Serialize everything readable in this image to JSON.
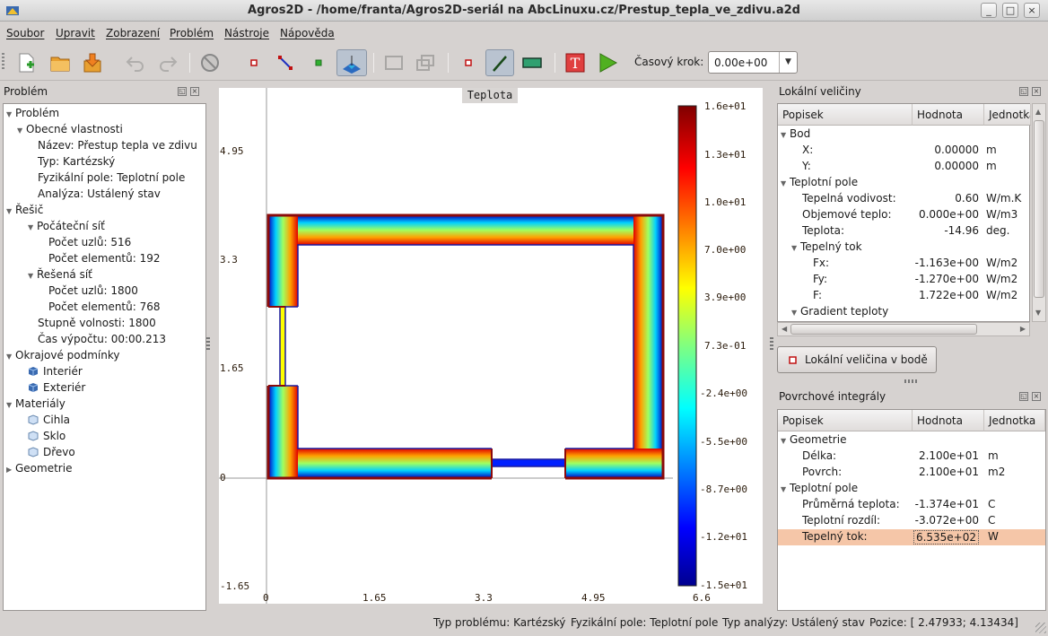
{
  "window": {
    "title": "Agros2D - /home/franta/Agros2D-seriál na AbcLinuxu.cz/Prestup_tepla_ve_zdivu.a2d"
  },
  "menu": [
    "Soubor",
    "Upravit",
    "Zobrazení",
    "Problém",
    "Nástroje",
    "Nápověda"
  ],
  "toolbar": {
    "step_label": "Časový krok:",
    "step_value": "0.00e+00"
  },
  "left_panel": {
    "title": "Problém",
    "tree": [
      "Problém",
      "Obecné vlastnosti",
      "Název: Přestup tepla ve zdivu",
      "Typ: Kartézský",
      "Fyzikální pole: Teplotní pole",
      "Analýza: Ustálený stav",
      "Řešič",
      "Počáteční síť",
      "Počet uzlů: 516",
      "Počet elementů: 192",
      "Řešená síť",
      "Počet uzlů: 1800",
      "Počet elementů: 768",
      "Stupně volnosti: 1800",
      "Čas výpočtu: 00:00.213",
      "Okrajové podmínky",
      "Interiér",
      "Exteriér",
      "Materiály",
      "Cihla",
      "Sklo",
      "Dřevo",
      "Geometrie"
    ]
  },
  "view": {
    "title": "Teplota",
    "y_ticks": [
      "4.95",
      "3.3",
      "1.65",
      "0",
      "-1.65"
    ],
    "x_ticks": [
      "0",
      "1.65",
      "3.3",
      "4.95",
      "6.6"
    ],
    "colorbar_labels": [
      "1.6e+01",
      "1.3e+01",
      "1.0e+01",
      "7.0e+00",
      "3.9e+00",
      "7.3e-01",
      "-2.4e+00",
      "-5.5e+00",
      "-8.7e+00",
      "-1.2e+01",
      "-1.5e+01"
    ]
  },
  "local_panel": {
    "title": "Lokální veličiny",
    "headers": [
      "Popisek",
      "Hodnota",
      "Jednotka"
    ],
    "rows": [
      {
        "label": "Bod",
        "value": "",
        "unit": ""
      },
      {
        "label": "X:",
        "value": "0.00000",
        "unit": "m"
      },
      {
        "label": "Y:",
        "value": "0.00000",
        "unit": "m"
      },
      {
        "label": "Teplotní pole",
        "value": "",
        "unit": ""
      },
      {
        "label": "Tepelná vodivost:",
        "value": "0.60",
        "unit": "W/m.K"
      },
      {
        "label": "Objemové teplo:",
        "value": "0.000e+00",
        "unit": "W/m3"
      },
      {
        "label": "Teplota:",
        "value": "-14.96",
        "unit": "deg."
      },
      {
        "label": "Tepelný tok",
        "value": "",
        "unit": ""
      },
      {
        "label": "Fx:",
        "value": "-1.163e+00",
        "unit": "W/m2"
      },
      {
        "label": "Fy:",
        "value": "-1.270e+00",
        "unit": "W/m2"
      },
      {
        "label": "F:",
        "value": "1.722e+00",
        "unit": "W/m2"
      },
      {
        "label": "Gradient teploty",
        "value": "",
        "unit": ""
      }
    ],
    "button": "Lokální veličina v bodě"
  },
  "surface_panel": {
    "title": "Povrchové integrály",
    "headers": [
      "Popisek",
      "Hodnota",
      "Jednotka"
    ],
    "rows": [
      {
        "label": "Geometrie",
        "value": "",
        "unit": ""
      },
      {
        "label": "Délka:",
        "value": "2.100e+01",
        "unit": "m"
      },
      {
        "label": "Povrch:",
        "value": "2.100e+01",
        "unit": "m2"
      },
      {
        "label": "Teplotní pole",
        "value": "",
        "unit": ""
      },
      {
        "label": "Průměrná teplota:",
        "value": "-1.374e+01",
        "unit": "C"
      },
      {
        "label": "Teplotní rozdíl:",
        "value": "-3.072e+00",
        "unit": "C"
      },
      {
        "label": "Tepelný tok:",
        "value": "6.535e+02",
        "unit": "W"
      }
    ]
  },
  "statusbar": {
    "problem_type": "Typ problému: Kartézský",
    "field": "Fyzikální pole: Teplotní pole",
    "analysis": "Typ analýzy: Ustálený stav",
    "position": "Pozice: [ 2.47933;  4.13434]"
  },
  "colors": {
    "accent": "#f5c6a8",
    "boundary": "#8b0a0a",
    "panel_bg": "#d6d2d0"
  }
}
